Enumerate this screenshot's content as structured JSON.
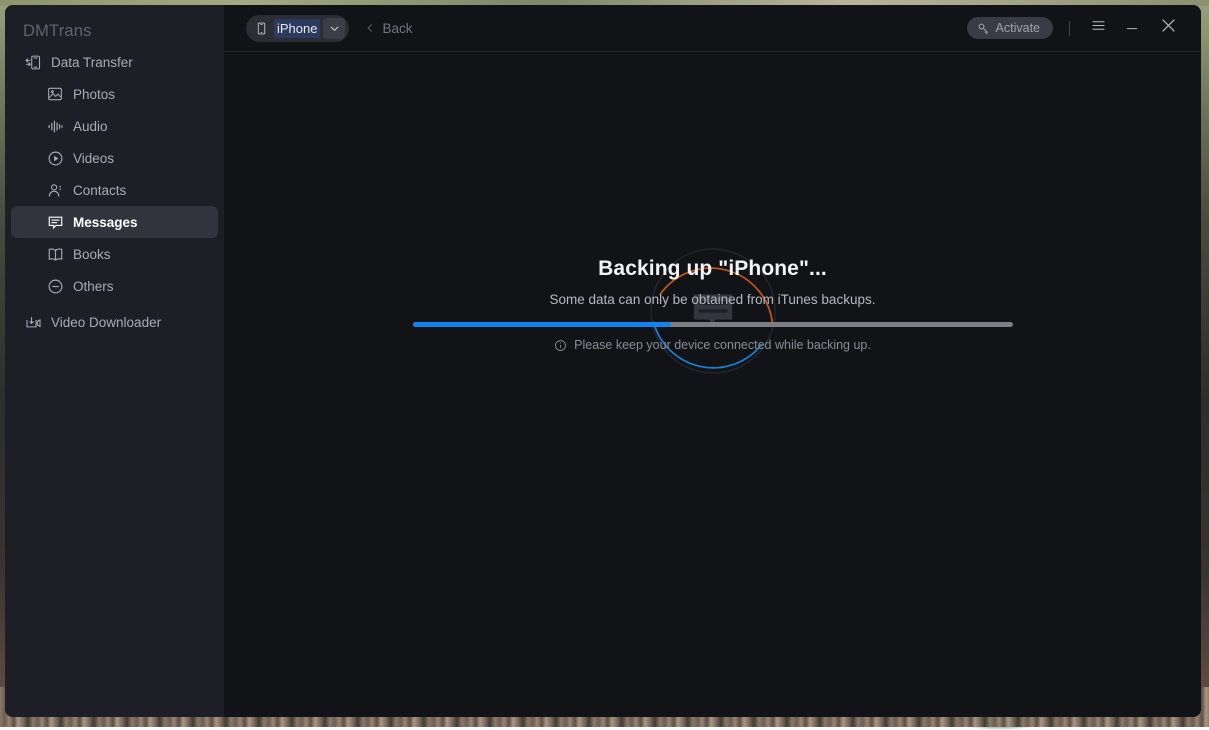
{
  "app": {
    "brand": "DMTrans"
  },
  "sidebar": {
    "items": [
      {
        "label": "Data Transfer",
        "icon": "phone-transfer-icon",
        "level": "top",
        "selected": false
      },
      {
        "label": "Photos",
        "icon": "photo-icon",
        "level": "sub",
        "selected": false
      },
      {
        "label": "Audio",
        "icon": "audio-wave-icon",
        "level": "sub",
        "selected": false
      },
      {
        "label": "Videos",
        "icon": "video-play-icon",
        "level": "sub",
        "selected": false
      },
      {
        "label": "Contacts",
        "icon": "contact-person-icon",
        "level": "sub",
        "selected": false
      },
      {
        "label": "Messages",
        "icon": "message-bubble-icon",
        "level": "sub",
        "selected": true
      },
      {
        "label": "Books",
        "icon": "book-icon",
        "level": "sub",
        "selected": false
      },
      {
        "label": "Others",
        "icon": "circle-minus-icon",
        "level": "sub",
        "selected": false
      },
      {
        "label": "Video Downloader",
        "icon": "video-download-icon",
        "level": "top",
        "selected": false
      }
    ]
  },
  "header": {
    "device_name": "iPhone",
    "device_icon": "phone-icon",
    "caret_icon": "chevron-down-icon",
    "back_label": "Back",
    "back_icon": "chevron-left-icon",
    "activate_label": "Activate",
    "activate_icon": "key-icon",
    "menu_icon": "hamburger-menu-icon",
    "minimize_icon": "minimize-icon",
    "close_icon": "close-icon"
  },
  "main": {
    "spinner_icon": "message-bubble-icon",
    "spinner_arc_top_color": "#c1571f",
    "spinner_arc_bottom_color": "#1b7fd4",
    "spinner_ring_color": "#24252c",
    "status_title": "Backing up \"iPhone\"...",
    "status_subtitle": "Some data can only be obtained from iTunes backups.",
    "progress_percent": 43,
    "progress_fill_color": "#1283ef",
    "progress_track_color": "#7c7e84",
    "hint_icon": "info-icon",
    "hint_text": "Please keep your device connected while backing up."
  }
}
